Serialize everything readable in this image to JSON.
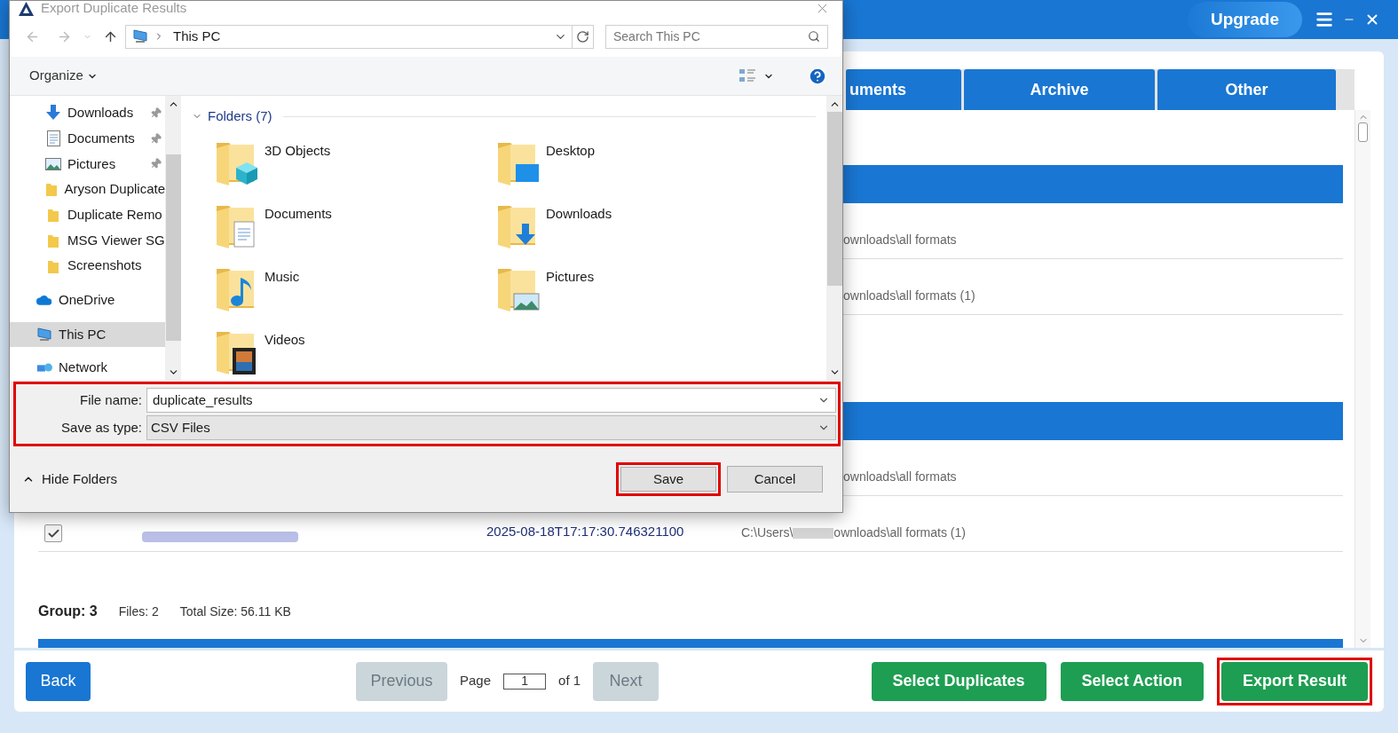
{
  "app": {
    "upgrade": "Upgrade",
    "tabs": [
      {
        "label": "uments"
      },
      {
        "label": "Archive"
      },
      {
        "label": "Other"
      }
    ],
    "groups": [
      {
        "rows": [
          {
            "path": "ownloads\\all formats"
          },
          {
            "path": "ownloads\\all formats (1)"
          }
        ]
      },
      {
        "rows": [
          {
            "path": "ownloads\\all formats"
          },
          {
            "checked": true,
            "file_blurred": true,
            "date": "2025-08-18T17:17:30.746321100",
            "path_prefix": "C:\\Users\\",
            "path_blurred": true,
            "path": "ownloads\\all formats (1)"
          }
        ]
      },
      {
        "label": "Group: 3",
        "files": "Files: 2",
        "size": "Total Size: 56.11 KB"
      }
    ]
  },
  "footer": {
    "back": "Back",
    "previous": {
      "label": "Previous",
      "disabled": true
    },
    "page_label": "Page",
    "page": "1",
    "of": "of 1",
    "next": {
      "label": "Next",
      "disabled": true
    },
    "actions": [
      {
        "label": "Select Duplicates",
        "highlighted": false
      },
      {
        "label": "Select Action",
        "highlighted": false
      },
      {
        "label": "Export Result",
        "highlighted": true
      }
    ]
  },
  "dialog": {
    "title": "Export Duplicate Results",
    "address": "This PC",
    "search": {
      "placeholder": "Search This PC"
    },
    "organize": "Organize",
    "nav": [
      {
        "label": "Downloads",
        "kind": "download",
        "pinned": true,
        "selected": false
      },
      {
        "label": "Documents",
        "kind": "document",
        "pinned": true,
        "selected": false
      },
      {
        "label": "Pictures",
        "kind": "picture",
        "pinned": true,
        "selected": false
      },
      {
        "label": "Aryson Duplicate",
        "kind": "folder",
        "pinned": false,
        "selected": false
      },
      {
        "label": "Duplicate Remo",
        "kind": "folder",
        "pinned": false,
        "selected": false
      },
      {
        "label": "MSG Viewer SG",
        "kind": "folder",
        "pinned": false,
        "selected": false
      },
      {
        "label": "Screenshots",
        "kind": "folder",
        "pinned": false,
        "selected": false
      },
      {
        "label": "OneDrive",
        "kind": "cloud",
        "pinned": false,
        "selected": false
      },
      {
        "label": "This PC",
        "kind": "computer",
        "pinned": false,
        "selected": true
      },
      {
        "label": "Network",
        "kind": "network",
        "pinned": false,
        "selected": false
      }
    ],
    "folders_header": "Folders (7)",
    "folders": [
      {
        "name": "3D Objects",
        "kind": "cube"
      },
      {
        "name": "Desktop",
        "kind": "desktop"
      },
      {
        "name": "Documents",
        "kind": "document"
      },
      {
        "name": "Downloads",
        "kind": "download"
      },
      {
        "name": "Music",
        "kind": "music"
      },
      {
        "name": "Pictures",
        "kind": "picture"
      },
      {
        "name": "Videos",
        "kind": "video"
      }
    ],
    "file_fields": {
      "highlighted": true,
      "items": [
        {
          "label": "File name:",
          "value": "duplicate_results",
          "kind": "input"
        },
        {
          "label": "Save as type:",
          "value": "CSV Files",
          "kind": "select"
        }
      ]
    },
    "hide_folders": "Hide Folders",
    "buttons": [
      {
        "label": "Save",
        "highlighted": true
      },
      {
        "label": "Cancel",
        "highlighted": false
      }
    ]
  }
}
